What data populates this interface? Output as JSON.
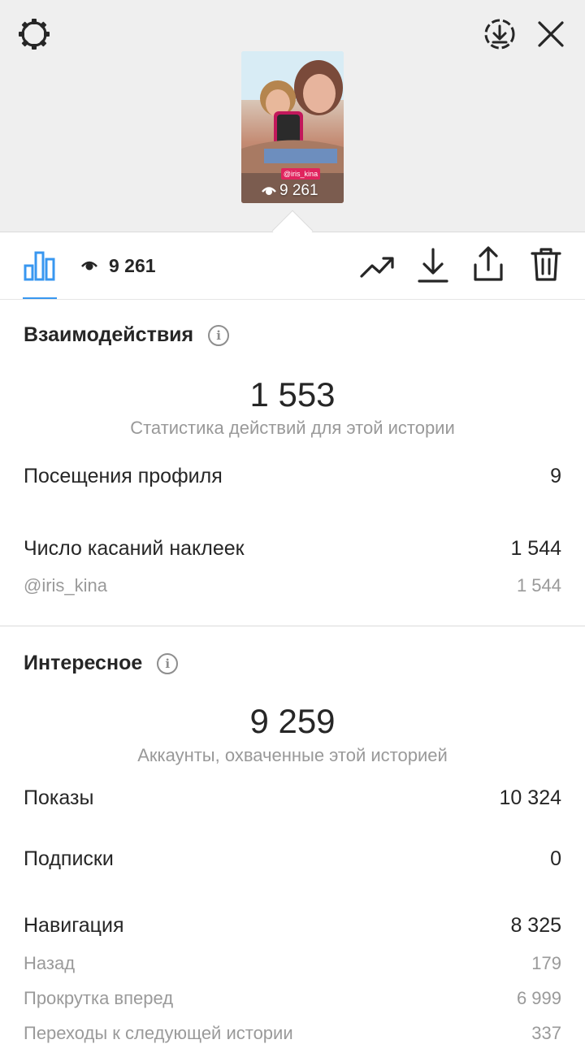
{
  "story": {
    "views": "9 261",
    "sticker": "@iris_kina"
  },
  "toolbar": {
    "views": "9 261"
  },
  "interactions": {
    "title": "Взаимодействия",
    "total": "1 553",
    "subtitle": "Статистика действий для этой истории",
    "rows": [
      {
        "label": "Посещения профиля",
        "value": "9"
      },
      {
        "label": "Число касаний наклеек",
        "value": "1 544"
      },
      {
        "label": "@iris_kina",
        "value": "1 544"
      }
    ]
  },
  "discovery": {
    "title": "Интересное",
    "total": "9 259",
    "subtitle": "Аккаунты, охваченные этой историей",
    "rows": [
      {
        "label": "Показы",
        "value": "10 324"
      },
      {
        "label": "Подписки",
        "value": "0"
      },
      {
        "label": "Навигация",
        "value": "8 325"
      },
      {
        "label": "Назад",
        "value": "179"
      },
      {
        "label": "Прокрутка вперед",
        "value": "6 999"
      },
      {
        "label": "Переходы к следующей истории",
        "value": "337"
      }
    ]
  },
  "colors": {
    "accent": "#3897f0",
    "sticker": "#e0245e",
    "secondary_text": "#999999"
  },
  "icons": [
    "settings-icon",
    "archive-download-icon",
    "close-icon",
    "bar-chart-icon",
    "eye-icon",
    "promote-trend-icon",
    "download-icon",
    "share-icon",
    "trash-icon",
    "info-icon"
  ]
}
